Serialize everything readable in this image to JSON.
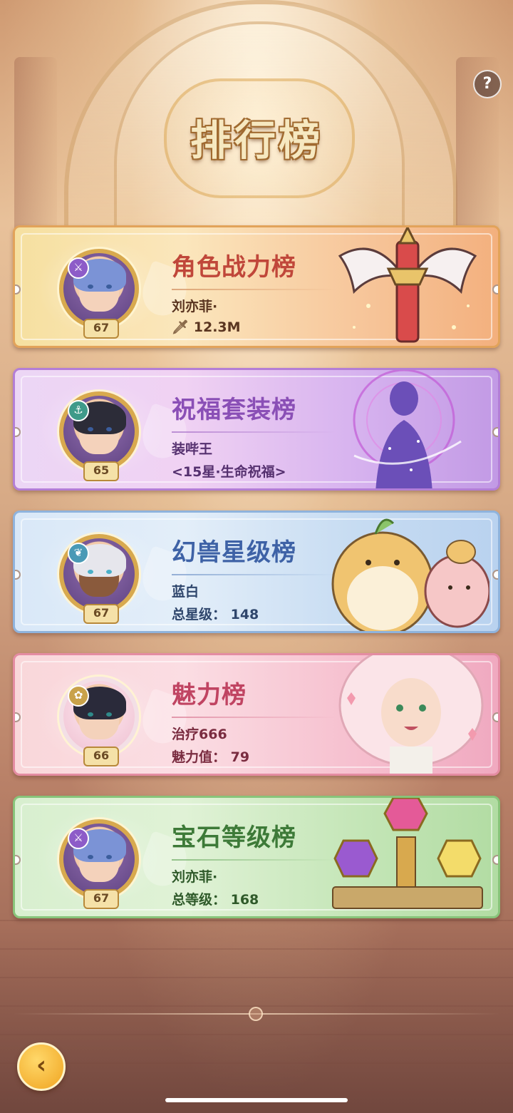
{
  "header": {
    "title": "排行榜",
    "help_label": "?"
  },
  "cards": [
    {
      "title": "角色战力榜",
      "line1": "刘亦菲·",
      "line2": "12.3M",
      "level": "67",
      "class_icon": "sword-class-icon",
      "stat_icon": "sword-icon",
      "accent": "#c0473a"
    },
    {
      "title": "祝福套装榜",
      "line1": "装哔王",
      "line2": "<15星·生命祝福>",
      "level": "65",
      "class_icon": "anchor-class-icon",
      "accent": "#8a4fb6"
    },
    {
      "title": "幻兽星级榜",
      "line1": "蓝白",
      "line2": "总星级： 148",
      "level": "67",
      "class_icon": "leaf-class-icon",
      "accent": "#3e62a6"
    },
    {
      "title": "魅力榜",
      "line1": "治疗666",
      "line2": "魅力值： 79",
      "level": "66",
      "class_icon": "flower-class-icon",
      "accent": "#c04462"
    },
    {
      "title": "宝石等级榜",
      "line1": "刘亦菲·",
      "line2": "总等级： 168",
      "level": "67",
      "class_icon": "sword-class-icon",
      "accent": "#3d7a38"
    }
  ],
  "footer": {
    "back_icon": "back-arrow-icon"
  }
}
